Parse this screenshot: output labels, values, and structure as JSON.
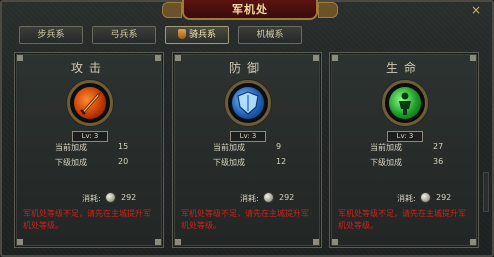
{
  "window": {
    "title": "军机处",
    "close_label": "×"
  },
  "tabs": [
    {
      "label": "步兵系",
      "active": false
    },
    {
      "label": "弓兵系",
      "active": false
    },
    {
      "label": "骑兵系",
      "active": true
    },
    {
      "label": "机械系",
      "active": false
    }
  ],
  "panels": [
    {
      "title": "攻击",
      "icon": "sword-icon",
      "level": "Lv: 3",
      "current_label": "当前加成",
      "current_value": "15",
      "next_label": "下级加成",
      "next_value": "20",
      "cost_label": "消耗:",
      "cost_value": "292",
      "warning": "军机处等级不足，请先在主城提升军机处等级。"
    },
    {
      "title": "防御",
      "icon": "shield-icon",
      "level": "Lv: 3",
      "current_label": "当前加成",
      "current_value": "9",
      "next_label": "下级加成",
      "next_value": "12",
      "cost_label": "消耗:",
      "cost_value": "292",
      "warning": "军机处等级不足，请先在主城提升军机处等级。"
    },
    {
      "title": "生命",
      "icon": "life-icon",
      "level": "Lv: 3",
      "current_label": "当前加成",
      "current_value": "27",
      "next_label": "下级加成",
      "next_value": "36",
      "cost_label": "消耗:",
      "cost_value": "292",
      "warning": "军机处等级不足，请先在主城提升军机处等级。"
    }
  ],
  "colors": {
    "warning": "#d3201a",
    "title_plaque": "#5a1412",
    "text": "#d7d2be"
  }
}
